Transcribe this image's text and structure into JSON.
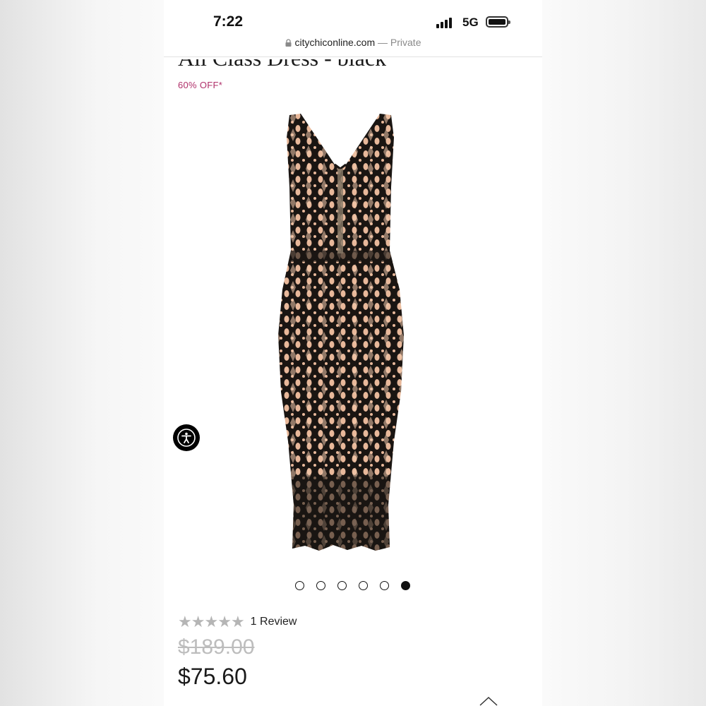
{
  "status_bar": {
    "time": "7:22",
    "network": "5G",
    "signal_icon": "cellular-signal-icon",
    "battery_icon": "battery-icon"
  },
  "browser": {
    "url": "citychiconline.com",
    "separator": " — ",
    "privacy": "Private",
    "lock_icon": "lock-icon"
  },
  "product": {
    "title": "All Class Dress - black",
    "discount": "60% OFF*",
    "image_alt_icon": "dress-photo",
    "carousel": {
      "total": 6,
      "active_index": 5
    },
    "rating": {
      "stars": 0,
      "max_stars": 5,
      "review_label": "1 Review"
    },
    "price_original": "$189.00",
    "price_sale": "$75.60"
  },
  "accessibility": {
    "icon": "accessibility-icon"
  },
  "colors": {
    "discount": "#b0306a",
    "star_empty": "#b5b5b5",
    "price_strike": "#bdbdbd",
    "dress_lace": "#1a1512",
    "dress_lining": "#e8b89a"
  }
}
